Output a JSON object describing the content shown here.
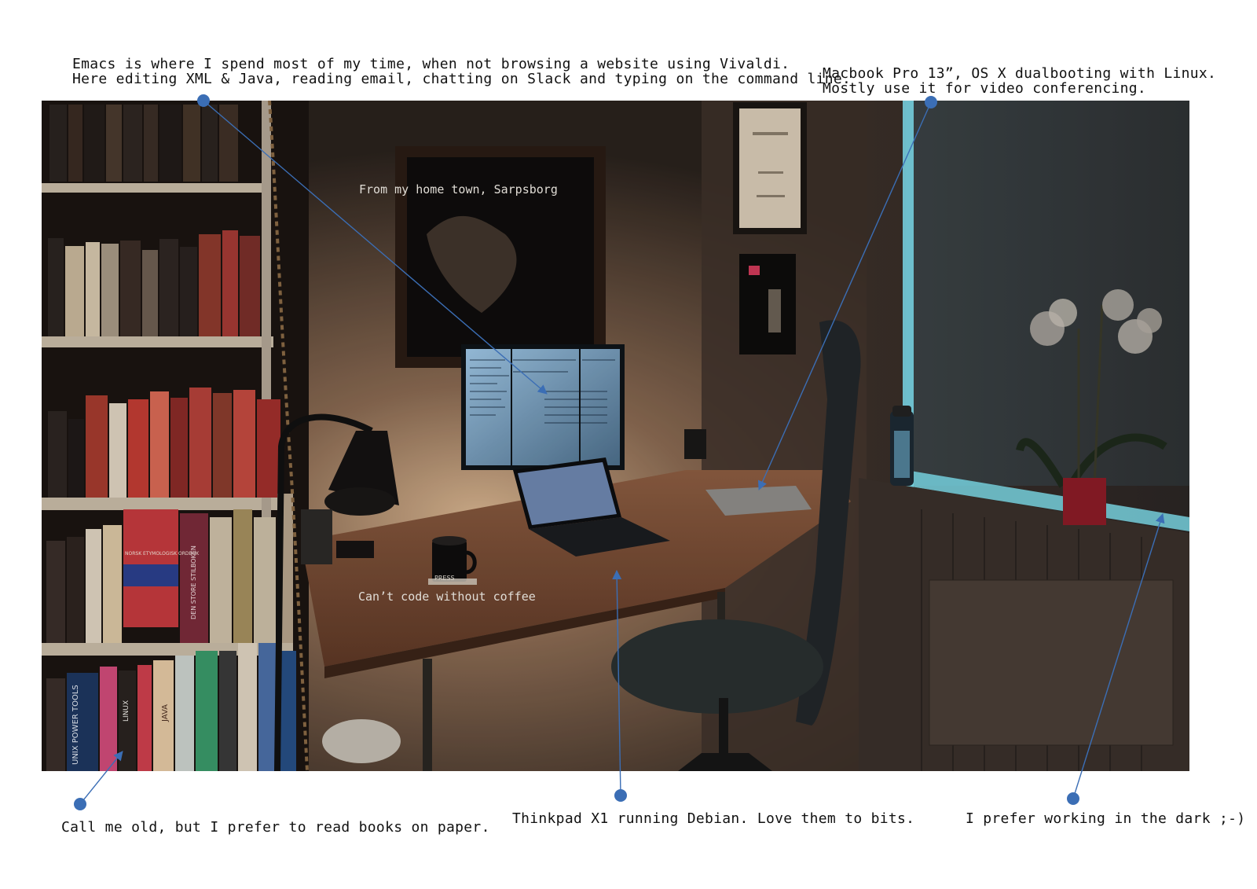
{
  "captions": {
    "top_left_line1": "Emacs is where I spend most of my time, when not browsing a website using Vivaldi.",
    "top_left_line2": "Here editing XML & Java, reading email, chatting on Slack and typing on the command line.",
    "top_right_line1": "Macbook Pro 13”, OS X dualbooting with Linux.",
    "top_right_line2": "Mostly use it for video conferencing.",
    "picture_label": "From my home town, Sarpsborg",
    "coffee_label": "Can’t code without coffee",
    "books": "Call me old, but I prefer to read books on paper.",
    "thinkpad": "Thinkpad X1 running Debian. Love them to bits.",
    "dark": "I prefer working in the dark ;-)"
  },
  "photo_text": {
    "book_spine_1": "UNIX POWER TOOLS",
    "book_spine_2": "LINUX",
    "book_spine_3": "JAVA",
    "book_spine_4": "NORSK ETYMOLOGISK ORDBOK",
    "book_spine_5": "DEN STORE STILBOKEN",
    "mug_text": "PRESS"
  },
  "colors": {
    "annotation": "#3b6eb5",
    "background": "#ffffff",
    "window_glow": "#7fe0ef"
  }
}
